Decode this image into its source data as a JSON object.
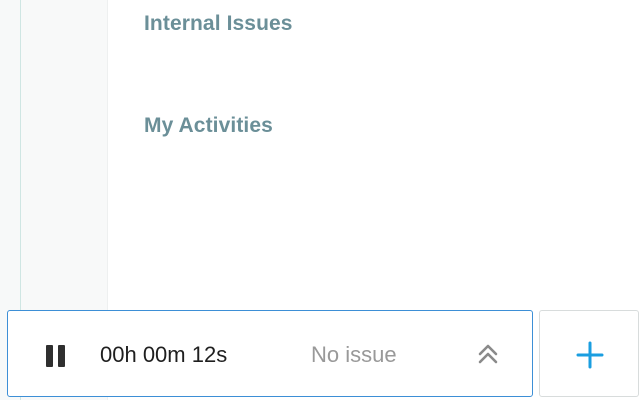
{
  "sections": [
    {
      "title": "Internal Issues"
    },
    {
      "title": "My Activities"
    }
  ],
  "timer": {
    "state": "running",
    "pause_icon": "pause-icon",
    "elapsed": "00h 00m 12s",
    "issue_label": "No issue",
    "expand_icon": "double-chevron-up-icon"
  },
  "add_button": {
    "icon": "plus-icon"
  },
  "colors": {
    "section_title": "#6b8f98",
    "timer_border": "#3d8fd6",
    "accent": "#1a9ee0",
    "muted_text": "#999999"
  }
}
